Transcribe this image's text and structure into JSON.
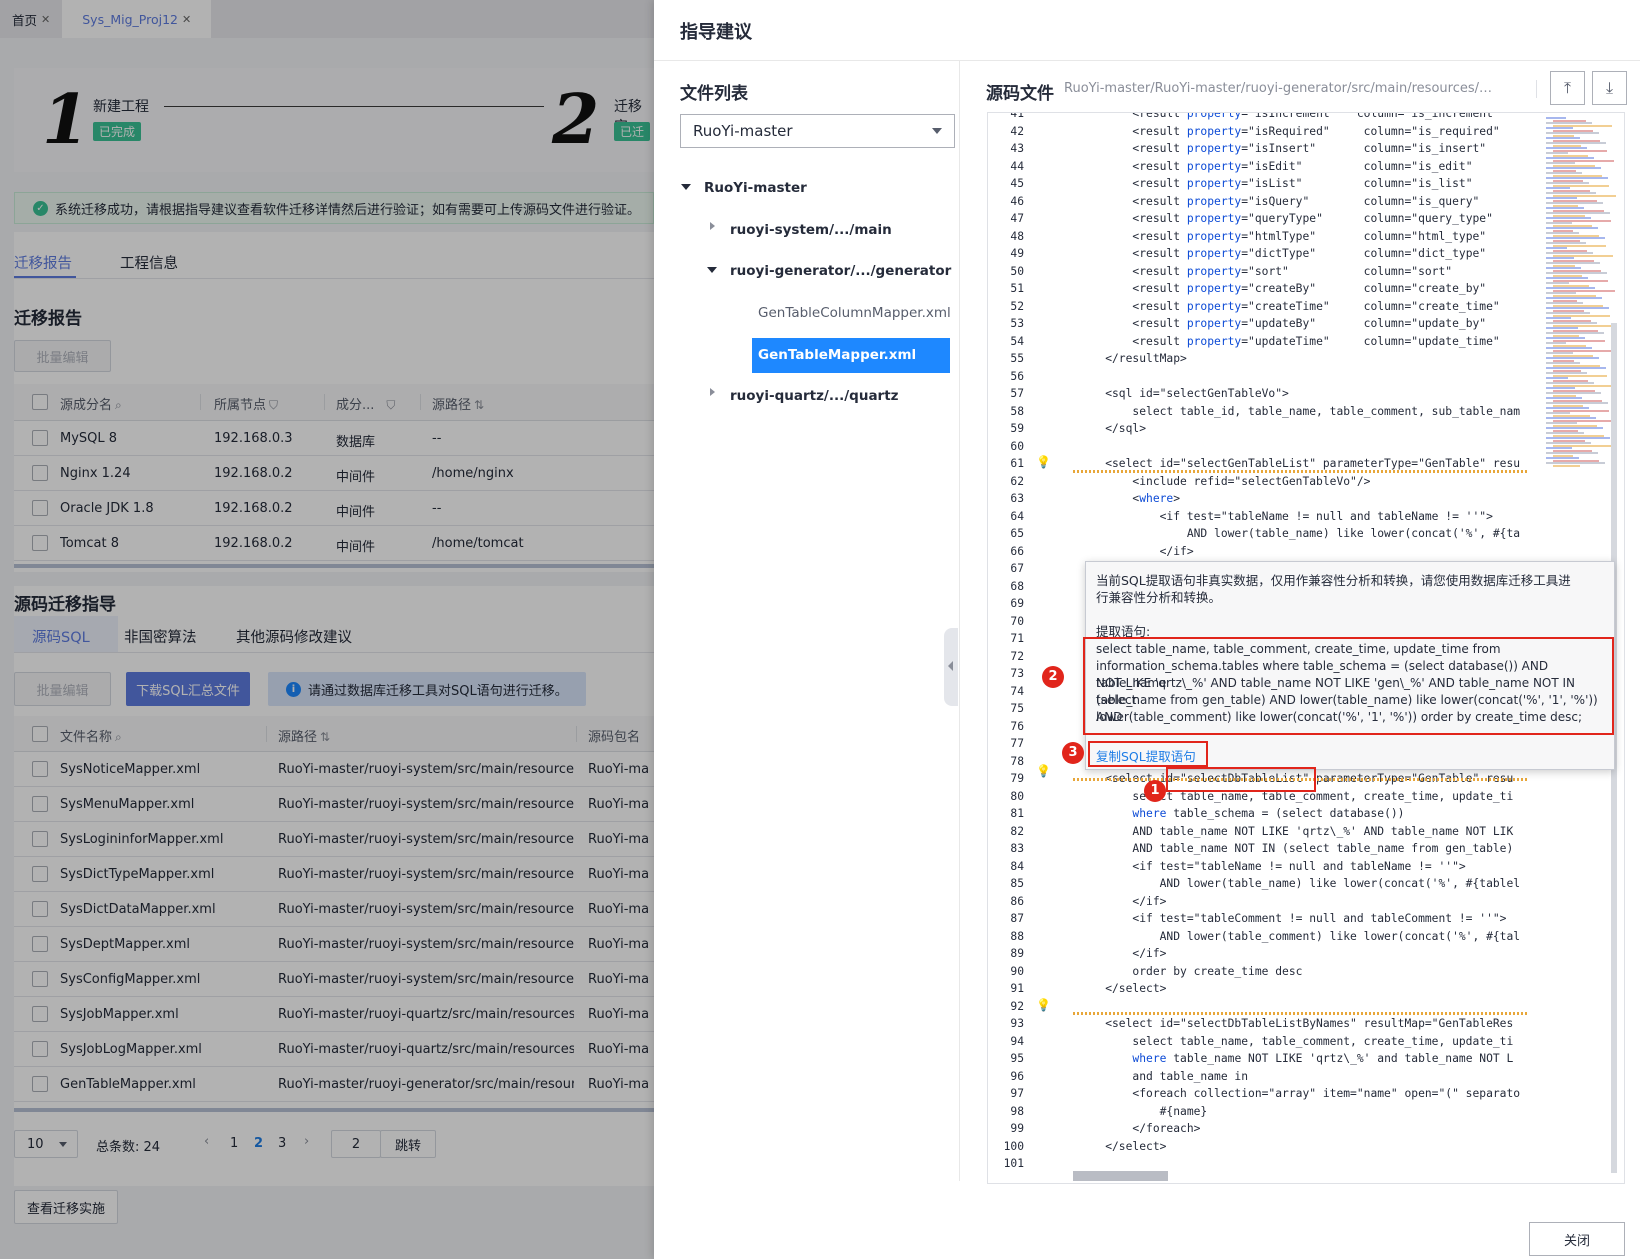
{
  "page_tabs": [
    {
      "label": "首页"
    },
    {
      "label": "Sys_Mig_Proj12"
    }
  ],
  "steps": [
    {
      "num": "1",
      "label": "新建工程",
      "status": "已完成"
    },
    {
      "num": "2",
      "label": "迁移实",
      "status": "已迁"
    }
  ],
  "alert": {
    "text": "系统迁移成功，请根据指导建议查看软件迁移详情然后进行验证；如有需要可上传源码文件进行验证。"
  },
  "report_tabs": [
    {
      "label": "迁移报告"
    },
    {
      "label": "工程信息"
    }
  ],
  "report": {
    "title": "迁移报告",
    "batch_edit": "批量编辑",
    "columns": [
      "源成分名",
      "所属节点",
      "成分...",
      "源路径"
    ],
    "rows": [
      {
        "name": "MySQL 8",
        "node": "192.168.0.3",
        "type": "数据库",
        "path": "--"
      },
      {
        "name": "Nginx 1.24",
        "node": "192.168.0.2",
        "type": "中间件",
        "path": "/home/nginx"
      },
      {
        "name": "Oracle JDK 1.8",
        "node": "192.168.0.2",
        "type": "中间件",
        "path": "--"
      },
      {
        "name": "Tomcat 8",
        "node": "192.168.0.2",
        "type": "中间件",
        "path": "/home/tomcat"
      }
    ]
  },
  "source": {
    "title": "源码迁移指导",
    "tabs": [
      {
        "label": "源码SQL"
      },
      {
        "label": "非国密算法"
      },
      {
        "label": "其他源码修改建议"
      }
    ],
    "batch_edit": "批量编辑",
    "download": "下载SQL汇总文件",
    "info": "请通过数据库迁移工具对SQL语句进行迁移。",
    "columns": [
      "文件名称",
      "源路径",
      "源码包名"
    ],
    "rows": [
      {
        "name": "SysNoticeMapper.xml",
        "path": "RuoYi-master/ruoyi-system/src/main/resources/...",
        "pkg": "RuoYi-ma"
      },
      {
        "name": "SysMenuMapper.xml",
        "path": "RuoYi-master/ruoyi-system/src/main/resources/...",
        "pkg": "RuoYi-ma"
      },
      {
        "name": "SysLogininforMapper.xml",
        "path": "RuoYi-master/ruoyi-system/src/main/resources/...",
        "pkg": "RuoYi-ma"
      },
      {
        "name": "SysDictTypeMapper.xml",
        "path": "RuoYi-master/ruoyi-system/src/main/resources/...",
        "pkg": "RuoYi-ma"
      },
      {
        "name": "SysDictDataMapper.xml",
        "path": "RuoYi-master/ruoyi-system/src/main/resources/...",
        "pkg": "RuoYi-ma"
      },
      {
        "name": "SysDeptMapper.xml",
        "path": "RuoYi-master/ruoyi-system/src/main/resources/...",
        "pkg": "RuoYi-ma"
      },
      {
        "name": "SysConfigMapper.xml",
        "path": "RuoYi-master/ruoyi-system/src/main/resources/...",
        "pkg": "RuoYi-ma"
      },
      {
        "name": "SysJobMapper.xml",
        "path": "RuoYi-master/ruoyi-quartz/src/main/resources/...",
        "pkg": "RuoYi-ma"
      },
      {
        "name": "SysJobLogMapper.xml",
        "path": "RuoYi-master/ruoyi-quartz/src/main/resources/...",
        "pkg": "RuoYi-ma"
      },
      {
        "name": "GenTableMapper.xml",
        "path": "RuoYi-master/ruoyi-generator/src/main/resource...",
        "pkg": "RuoYi-ma"
      }
    ],
    "pager": {
      "size": "10",
      "total": "总条数: 24",
      "pages": [
        "1",
        "2",
        "3"
      ],
      "current": "2",
      "jump_value": "2",
      "jump": "跳转"
    },
    "view_btn": "查看迁移实施"
  },
  "drawer": {
    "title": "指导建议",
    "file_list_title": "文件列表",
    "select_value": "RuoYi-master",
    "tree": {
      "root": "RuoYi-master",
      "n1": "ruoyi-system/.../main",
      "n2": "ruoyi-generator/.../generator",
      "f1": "GenTableColumnMapper.xml",
      "f2": "GenTableMapper.xml",
      "n3": "ruoyi-quartz/.../quartz"
    },
    "source_title": "源码文件",
    "source_path": "RuoYi-master/RuoYi-master/ruoyi-generator/src/main/resources/mapper/...",
    "tooltip": {
      "line1": "当前SQL提取语句非真实数据，仅用作兼容性分析和转换，请您使用数据库迁移工具进",
      "line2": "行兼容性分析和转换。",
      "label": "提取语句:",
      "sql": [
        "select table_name, table_comment, create_time, update_time from",
        "information_schema.tables where table_schema = (select database()) AND table_name",
        "NOT LIKE 'qrtz\\_%' AND table_name NOT LIKE 'gen\\_%' AND table_name NOT IN (select",
        "table_name from gen_table) AND lower(table_name) like lower(concat('%', '1', '%')) AND",
        "lower(table_comment) like lower(concat('%', '1', '%')) order by create_time desc;"
      ],
      "copy": "复制SQL提取语句"
    },
    "markers": [
      "1",
      "2",
      "3"
    ],
    "close": "关闭"
  },
  "code_lines": [
    {
      "n": "41",
      "t": "        <result property=\"isIncrement\"   column=\"is_increment\""
    },
    {
      "n": "42",
      "t": "        <result property=\"isRequired\"     column=\"is_required\""
    },
    {
      "n": "43",
      "t": "        <result property=\"isInsert\"       column=\"is_insert\""
    },
    {
      "n": "44",
      "t": "        <result property=\"isEdit\"         column=\"is_edit\""
    },
    {
      "n": "45",
      "t": "        <result property=\"isList\"         column=\"is_list\""
    },
    {
      "n": "46",
      "t": "        <result property=\"isQuery\"        column=\"is_query\""
    },
    {
      "n": "47",
      "t": "        <result property=\"queryType\"      column=\"query_type\""
    },
    {
      "n": "48",
      "t": "        <result property=\"htmlType\"       column=\"html_type\""
    },
    {
      "n": "49",
      "t": "        <result property=\"dictType\"       column=\"dict_type\""
    },
    {
      "n": "50",
      "t": "        <result property=\"sort\"           column=\"sort\""
    },
    {
      "n": "51",
      "t": "        <result property=\"createBy\"       column=\"create_by\""
    },
    {
      "n": "52",
      "t": "        <result property=\"createTime\"     column=\"create_time\""
    },
    {
      "n": "53",
      "t": "        <result property=\"updateBy\"       column=\"update_by\""
    },
    {
      "n": "54",
      "t": "        <result property=\"updateTime\"     column=\"update_time\""
    },
    {
      "n": "55",
      "t": "    </resultMap>"
    },
    {
      "n": "56",
      "t": ""
    },
    {
      "n": "57",
      "t": "    <sql id=\"selectGenTableVo\">"
    },
    {
      "n": "58",
      "t": "        select table_id, table_name, table_comment, sub_table_nam"
    },
    {
      "n": "59",
      "t": "    </sql>"
    },
    {
      "n": "60",
      "t": ""
    },
    {
      "n": "61",
      "t": "    <select id=\"selectGenTableList\" parameterType=\"GenTable\" resu"
    },
    {
      "n": "62",
      "t": "        <include refid=\"selectGenTableVo\"/>"
    },
    {
      "n": "63",
      "t": "        <where>"
    },
    {
      "n": "64",
      "t": "            <if test=\"tableName != null and tableName != ''\">"
    },
    {
      "n": "65",
      "t": "                AND lower(table_name) like lower(concat('%', #{ta"
    },
    {
      "n": "66",
      "t": "            </if>"
    },
    {
      "n": "67",
      "t": ""
    },
    {
      "n": "68",
      "t": ""
    },
    {
      "n": "69",
      "t": ""
    },
    {
      "n": "70",
      "t": ""
    },
    {
      "n": "71",
      "t": ""
    },
    {
      "n": "72",
      "t": ""
    },
    {
      "n": "73",
      "t": ""
    },
    {
      "n": "74",
      "t": ""
    },
    {
      "n": "75",
      "t": ""
    },
    {
      "n": "76",
      "t": ""
    },
    {
      "n": "77",
      "t": ""
    },
    {
      "n": "78",
      "t": ""
    },
    {
      "n": "79",
      "t": "    <select id=\"selectDbTableList\" parameterType=\"GenTable\" resu"
    },
    {
      "n": "80",
      "t": "        select table_name, table_comment, create_time, update_ti"
    },
    {
      "n": "81",
      "t": "        where table_schema = (select database())"
    },
    {
      "n": "82",
      "t": "        AND table_name NOT LIKE 'qrtz\\_%' AND table_name NOT LIK"
    },
    {
      "n": "83",
      "t": "        AND table_name NOT IN (select table_name from gen_table)"
    },
    {
      "n": "84",
      "t": "        <if test=\"tableName != null and tableName != ''\">"
    },
    {
      "n": "85",
      "t": "            AND lower(table_name) like lower(concat('%', #{tablel"
    },
    {
      "n": "86",
      "t": "        </if>"
    },
    {
      "n": "87",
      "t": "        <if test=\"tableComment != null and tableComment != ''\">"
    },
    {
      "n": "88",
      "t": "            AND lower(table_comment) like lower(concat('%', #{tal"
    },
    {
      "n": "89",
      "t": "        </if>"
    },
    {
      "n": "90",
      "t": "        order by create_time desc"
    },
    {
      "n": "91",
      "t": "    </select>"
    },
    {
      "n": "92",
      "t": ""
    },
    {
      "n": "93",
      "t": "    <select id=\"selectDbTableListByNames\" resultMap=\"GenTableRes"
    },
    {
      "n": "94",
      "t": "        select table_name, table_comment, create_time, update_ti"
    },
    {
      "n": "95",
      "t": "        where table_name NOT LIKE 'qrtz\\_%' and table_name NOT L"
    },
    {
      "n": "96",
      "t": "        and table_name in"
    },
    {
      "n": "97",
      "t": "        <foreach collection=\"array\" item=\"name\" open=\"(\" separato"
    },
    {
      "n": "98",
      "t": "            #{name}"
    },
    {
      "n": "99",
      "t": "        </foreach>"
    },
    {
      "n": "100",
      "t": "    </select>"
    },
    {
      "n": "101",
      "t": ""
    }
  ]
}
